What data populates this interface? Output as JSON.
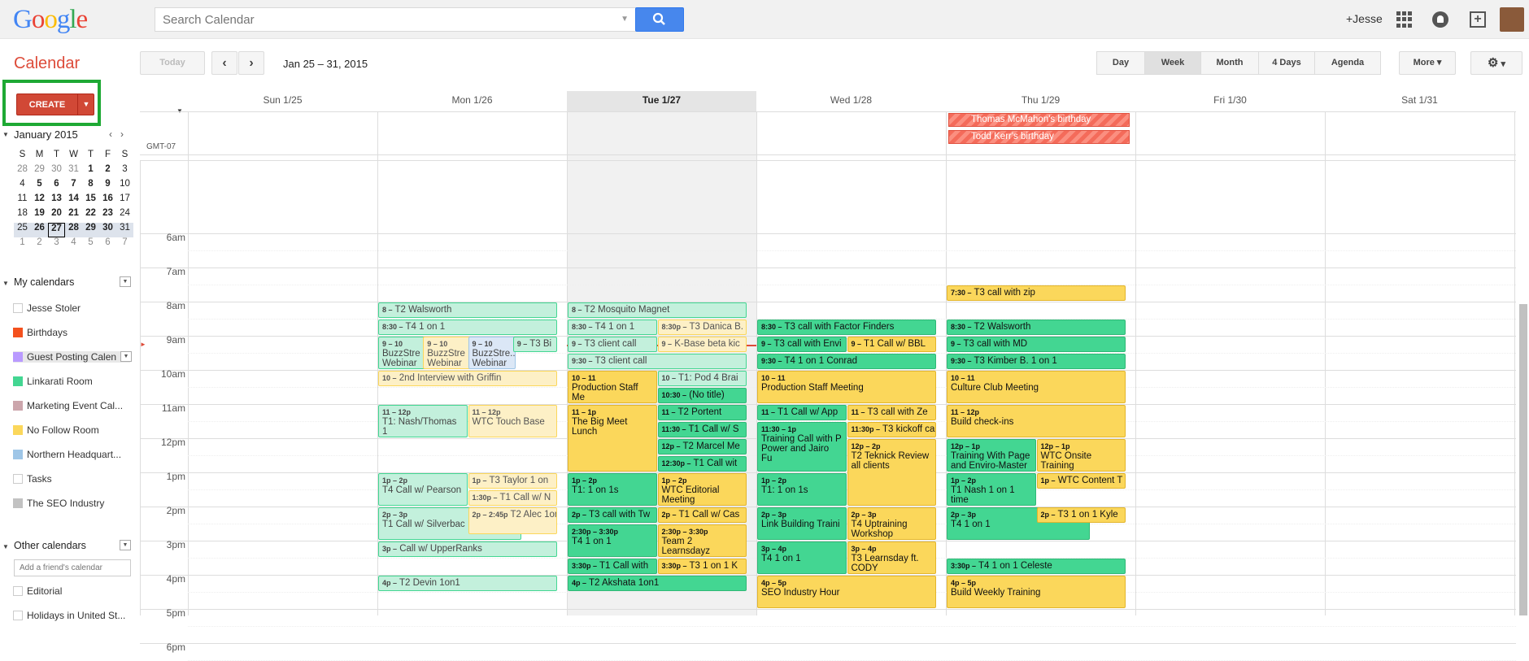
{
  "logo": "Google",
  "search": {
    "placeholder": "Search Calendar"
  },
  "user": "+Jesse",
  "app_title": "Calendar",
  "create_label": "CREATE",
  "toolbar": {
    "today": "Today",
    "date_range": "Jan 25 – 31, 2015",
    "views": [
      "Day",
      "Week",
      "Month",
      "4 Days",
      "Agenda"
    ],
    "active_view": "Week",
    "more": "More"
  },
  "mini_calendar": {
    "title": "January 2015",
    "day_names": [
      "S",
      "M",
      "T",
      "W",
      "T",
      "F",
      "S"
    ],
    "weeks": [
      [
        "28",
        "29",
        "30",
        "31",
        "1",
        "2",
        "3"
      ],
      [
        "4",
        "5",
        "6",
        "7",
        "8",
        "9",
        "10"
      ],
      [
        "11",
        "12",
        "13",
        "14",
        "15",
        "16",
        "17"
      ],
      [
        "18",
        "19",
        "20",
        "21",
        "22",
        "23",
        "24"
      ],
      [
        "25",
        "26",
        "27",
        "28",
        "29",
        "30",
        "31"
      ],
      [
        "1",
        "2",
        "3",
        "4",
        "5",
        "6",
        "7"
      ]
    ]
  },
  "my_calendars": {
    "title": "My calendars",
    "items": [
      {
        "name": "Jesse Stoler",
        "color": "#ffffff"
      },
      {
        "name": "Birthdays",
        "color": "#f4511e"
      },
      {
        "name": "Guest Posting Calen",
        "color": "#b99aff"
      },
      {
        "name": "Linkarati Room",
        "color": "#43d692"
      },
      {
        "name": "Marketing Event Cal...",
        "color": "#cca6ac"
      },
      {
        "name": "No Follow Room",
        "color": "#fbd75b"
      },
      {
        "name": "Northern Headquart...",
        "color": "#9fc6e7"
      },
      {
        "name": "Tasks",
        "color": "#ffffff"
      },
      {
        "name": "The SEO Industry",
        "color": "#c2c2c2"
      }
    ]
  },
  "other_calendars": {
    "title": "Other calendars",
    "add_placeholder": "Add a friend's calendar",
    "items": [
      {
        "name": "Editorial",
        "color": "#ffffff"
      },
      {
        "name": "Holidays in United St...",
        "color": "#ffffff"
      }
    ]
  },
  "days": [
    "Sun 1/25",
    "Mon 1/26",
    "Tue 1/27",
    "Wed 1/28",
    "Thu 1/29",
    "Fri 1/30",
    "Sat 1/31"
  ],
  "timezone": "GMT-07",
  "hours": [
    "6am",
    "7am",
    "8am",
    "9am",
    "10am",
    "11am",
    "12pm",
    "1pm",
    "2pm",
    "3pm",
    "4pm",
    "5pm",
    "6pm"
  ],
  "allday": [
    "Thomas McMahon's birthday",
    "Todd Kerr's birthday"
  ],
  "events": [
    {
      "day": 1,
      "time": "8 –",
      "title": "T2 Walsworth",
      "style": "lg"
    },
    {
      "day": 1,
      "time": "8:30 –",
      "title": "T4 1 on 1",
      "style": "lg"
    },
    {
      "day": 1,
      "time": "9 – 10",
      "title": "BuzzStre Webinar",
      "style": "lg"
    },
    {
      "day": 1,
      "time": "9 – 10",
      "title": "BuzzStre Webinar",
      "style": "ly"
    },
    {
      "day": 1,
      "time": "9 – 10",
      "title": "BuzzStre... Webinar w/ Tim",
      "style": "lb"
    },
    {
      "day": 1,
      "time": "9 –",
      "title": "T3 Bi",
      "style": "lg"
    },
    {
      "day": 1,
      "time": "10 –",
      "title": "2nd Interview with Griffin",
      "style": "ly"
    },
    {
      "day": 1,
      "time": "11 – 12p",
      "title": "T1: Nash/Thomas 1",
      "style": "lg"
    },
    {
      "day": 1,
      "time": "11 – 12p",
      "title": "WTC Touch Base",
      "style": "ly"
    },
    {
      "day": 1,
      "time": "1p – 2p",
      "title": "T4 Call w/ Pearson",
      "style": "lg"
    },
    {
      "day": 1,
      "time": "1p –",
      "title": "T3 Taylor 1 on",
      "style": "ly"
    },
    {
      "day": 1,
      "time": "1:30p –",
      "title": "T1 Call w/ N",
      "style": "ly"
    },
    {
      "day": 1,
      "time": "2p – 3p",
      "title": "T1 Call w/ Silverbac",
      "style": "lg"
    },
    {
      "day": 1,
      "time": "2p – 2:45p",
      "title": "T2 Alec 1on1",
      "style": "ly"
    },
    {
      "day": 1,
      "time": "3p –",
      "title": "Call w/ UpperRanks",
      "style": "lg"
    },
    {
      "day": 1,
      "time": "4p –",
      "title": "T2 Devin 1on1",
      "style": "lg"
    },
    {
      "day": 2,
      "time": "8 –",
      "title": "T2 Mosquito Magnet",
      "style": "lg"
    },
    {
      "day": 2,
      "time": "8:30 –",
      "title": "T4 1 on 1",
      "style": "lg"
    },
    {
      "day": 2,
      "time": "8:30p –",
      "title": "T3 Danica B.",
      "style": "ly"
    },
    {
      "day": 2,
      "time": "9 –",
      "title": "T3 client call",
      "style": "lg"
    },
    {
      "day": 2,
      "time": "9 –",
      "title": "K-Base beta kic",
      "style": "ly"
    },
    {
      "day": 2,
      "time": "9:30 –",
      "title": "T3 client call",
      "style": "lg"
    },
    {
      "day": 2,
      "time": "10 – 11",
      "title": "Production Staff Me",
      "style": "y"
    },
    {
      "day": 2,
      "time": "10 –",
      "title": "T1: Pod 4 Brai",
      "style": "lg"
    },
    {
      "day": 2,
      "time": "10:30 –",
      "title": "(No title)",
      "style": "g"
    },
    {
      "day": 2,
      "time": "11 – 1p",
      "title": "The Big Meet Lunch",
      "style": "y"
    },
    {
      "day": 2,
      "time": "11 –",
      "title": "T2 Portent",
      "style": "g"
    },
    {
      "day": 2,
      "time": "11:30 –",
      "title": "T1 Call w/ S",
      "style": "g"
    },
    {
      "day": 2,
      "time": "12p –",
      "title": "T2 Marcel Me",
      "style": "g"
    },
    {
      "day": 2,
      "time": "12:30p –",
      "title": "T1 Call wit",
      "style": "g"
    },
    {
      "day": 2,
      "time": "1p – 2p",
      "title": "T1: 1 on 1s",
      "style": "g"
    },
    {
      "day": 2,
      "time": "1p – 2p",
      "title": "WTC Editorial Meeting",
      "style": "y"
    },
    {
      "day": 2,
      "time": "2p –",
      "title": "T3 call with Tw",
      "style": "g"
    },
    {
      "day": 2,
      "time": "2p –",
      "title": "T1 Call w/ Cas",
      "style": "y"
    },
    {
      "day": 2,
      "time": "2:30p – 3:30p",
      "title": "T4 1 on 1",
      "style": "g"
    },
    {
      "day": 2,
      "time": "2:30p – 3:30p",
      "title": "Team 2 Learnsdayz",
      "style": "y"
    },
    {
      "day": 2,
      "time": "3:30p –",
      "title": "T1 Call with",
      "style": "g"
    },
    {
      "day": 2,
      "time": "3:30p –",
      "title": "T3 1 on 1 K",
      "style": "y"
    },
    {
      "day": 2,
      "time": "4p –",
      "title": "T2 Akshata 1on1",
      "style": "g"
    },
    {
      "day": 3,
      "time": "8:30 –",
      "title": "T3 call with Factor Finders",
      "style": "g"
    },
    {
      "day": 3,
      "time": "9 –",
      "title": "T3 call with Envi",
      "style": "g"
    },
    {
      "day": 3,
      "time": "9 –",
      "title": "T1 Call w/ BBL",
      "style": "y"
    },
    {
      "day": 3,
      "time": "9:30 –",
      "title": "T4 1 on 1 Conrad",
      "style": "g"
    },
    {
      "day": 3,
      "time": "10 – 11",
      "title": "Production Staff Meeting",
      "style": "y"
    },
    {
      "day": 3,
      "time": "11 –",
      "title": "T1 Call w/ App",
      "style": "g"
    },
    {
      "day": 3,
      "time": "11 –",
      "title": "T3 call with Ze",
      "style": "y"
    },
    {
      "day": 3,
      "time": "11:30 – 1p",
      "title": "Training Call with P Power and Jairo Fu",
      "style": "g"
    },
    {
      "day": 3,
      "time": "11:30p –",
      "title": "T3 kickoff ca",
      "style": "y"
    },
    {
      "day": 3,
      "time": "12p – 2p",
      "title": "T2 Teknick Review all clients",
      "style": "y"
    },
    {
      "day": 3,
      "time": "1p – 2p",
      "title": "T1: 1 on 1s",
      "style": "g"
    },
    {
      "day": 3,
      "time": "2p – 3p",
      "title": "Link Building Traini",
      "style": "g"
    },
    {
      "day": 3,
      "time": "2p – 3p",
      "title": "T4 Uptraining Workshop",
      "style": "y"
    },
    {
      "day": 3,
      "time": "3p – 4p",
      "title": "T4 1 on 1",
      "style": "g"
    },
    {
      "day": 3,
      "time": "3p – 4p",
      "title": "T3 Learnsday ft. CODY",
      "style": "y"
    },
    {
      "day": 3,
      "time": "4p – 5p",
      "title": "SEO Industry Hour",
      "style": "y"
    },
    {
      "day": 4,
      "time": "7:30 –",
      "title": "T3 call with zip",
      "style": "y"
    },
    {
      "day": 4,
      "time": "8:30 –",
      "title": "T2 Walsworth",
      "style": "g"
    },
    {
      "day": 4,
      "time": "9 –",
      "title": "T3 call with MD",
      "style": "g"
    },
    {
      "day": 4,
      "time": "9:30 –",
      "title": "T3 Kimber B. 1 on 1",
      "style": "g"
    },
    {
      "day": 4,
      "time": "10 – 11",
      "title": "Culture Club Meeting",
      "style": "y"
    },
    {
      "day": 4,
      "time": "11 – 12p",
      "title": "Build check-ins",
      "style": "y"
    },
    {
      "day": 4,
      "time": "12p – 1p",
      "title": "Training With Page and Enviro-Master",
      "style": "g"
    },
    {
      "day": 4,
      "time": "12p – 1p",
      "title": "WTC Onsite Training",
      "style": "y"
    },
    {
      "day": 4,
      "time": "1p – 2p",
      "title": "T1 Nash 1 on 1 time",
      "style": "g"
    },
    {
      "day": 4,
      "time": "1p –",
      "title": "WTC Content T",
      "style": "y"
    },
    {
      "day": 4,
      "time": "2p – 3p",
      "title": "T4 1 on 1",
      "style": "g"
    },
    {
      "day": 4,
      "time": "2p –",
      "title": "T3 1 on 1 Kyle",
      "style": "y"
    },
    {
      "day": 4,
      "time": "3:30p –",
      "title": "T4 1 on 1 Celeste",
      "style": "g"
    },
    {
      "day": 4,
      "time": "4p – 5p",
      "title": "Build Weekly Training",
      "style": "y"
    }
  ]
}
